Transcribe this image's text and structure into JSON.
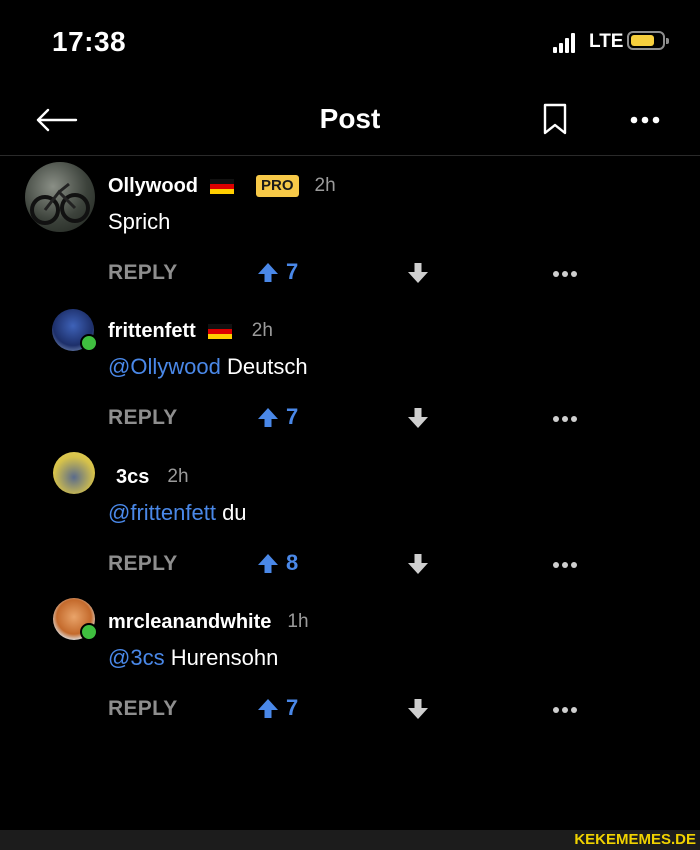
{
  "status_bar": {
    "time": "17:38",
    "network": "LTE",
    "battery_color": "#f7cf3d"
  },
  "nav": {
    "title": "Post",
    "back_icon": "arrow-left-icon",
    "bookmark_icon": "bookmark-icon",
    "more_icon": "more-horizontal-icon"
  },
  "colors": {
    "accent": "#4a88e8",
    "pro_badge": "#f7c948",
    "online": "#3fbf3f",
    "muted": "#8e8e8e"
  },
  "comments": [
    {
      "username": "Ollywood",
      "pro_label": "PRO",
      "time": "2h",
      "mention": "",
      "text": "Sprich",
      "reply_label": "REPLY",
      "upvotes": "7"
    },
    {
      "username": "frittenfett",
      "time": "2h",
      "mention": "@Ollywood",
      "text": "Deutsch",
      "reply_label": "REPLY",
      "upvotes": "7"
    },
    {
      "username": "3cs",
      "time": "2h",
      "mention": "@frittenfett",
      "text": "du",
      "reply_label": "REPLY",
      "upvotes": "8"
    },
    {
      "username": "mrcleanandwhite",
      "time": "1h",
      "mention": "@3cs",
      "text": "Hurensohn",
      "reply_label": "REPLY",
      "upvotes": "7"
    }
  ],
  "watermark": "KEKEMEMES.DE"
}
